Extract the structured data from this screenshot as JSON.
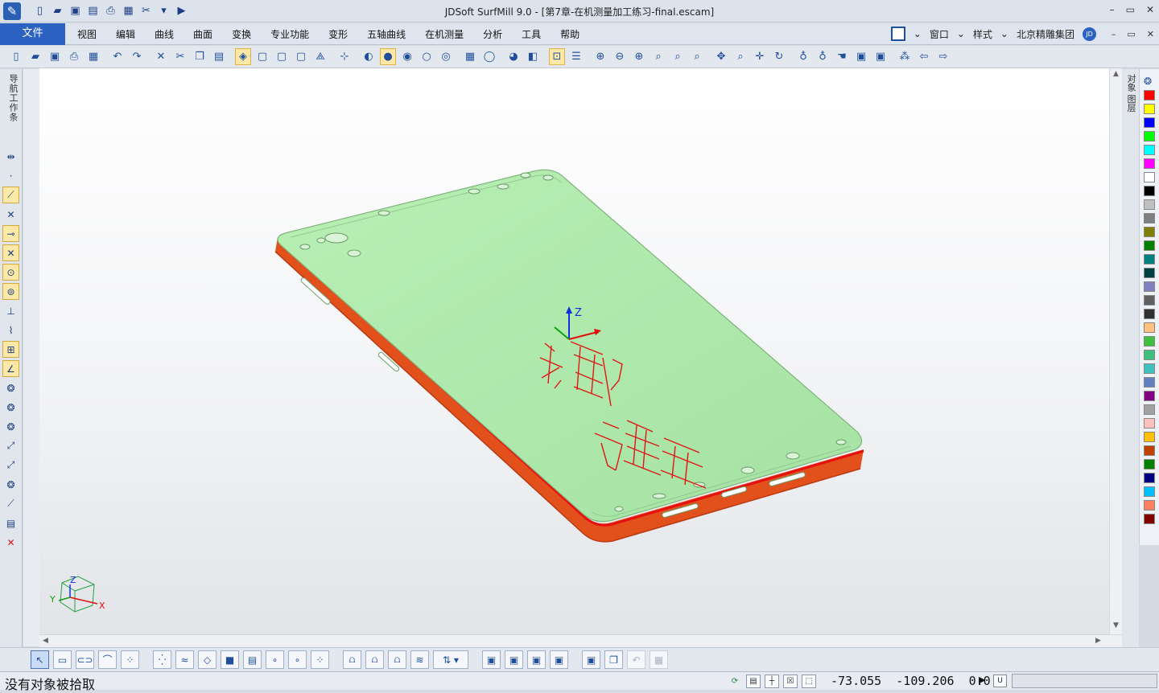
{
  "app": {
    "title": "JDSoft SurfMill 9.0 - [第7章-在机测量加工练习-final.escam]",
    "logo_icon": "surfmill-logo-icon"
  },
  "window_controls": {
    "minimize": "–",
    "restore": "▭",
    "close": "✕"
  },
  "quick_access": [
    "new-file-icon",
    "open-file-icon",
    "save-icon",
    "save-as-icon",
    "print-icon",
    "save-all-icon",
    "tools-icon",
    "dropdown-icon",
    "run-icon"
  ],
  "menu": {
    "file_label": "文件",
    "items": [
      "视图",
      "编辑",
      "曲线",
      "曲面",
      "变换",
      "专业功能",
      "变形",
      "五轴曲线",
      "在机测量",
      "分析",
      "工具",
      "帮助"
    ],
    "window_label": "窗口",
    "style_label": "样式",
    "company_label": "北京精雕集团",
    "avatar_text": "JD"
  },
  "left_panel": {
    "nav_tab": "导航工作条"
  },
  "right_panel": {
    "layer_tab": "对象 图层"
  },
  "viewport": {
    "axis_z_label": "Z",
    "triad": {
      "x": "X",
      "y": "Y",
      "z": "Z"
    },
    "engraved_text": "精雕"
  },
  "palette": {
    "colors": [
      "#ff0000",
      "#ffff00",
      "#0000ff",
      "#00ff00",
      "#00ffff",
      "#ff00ff",
      "#ffffff",
      "#000000",
      "#c0c0c0",
      "#808080",
      "#808000",
      "#008000",
      "#008080",
      "#004040",
      "#8080c0",
      "#606060",
      "#303030",
      "#ffc080",
      "#40c040",
      "#40c080",
      "#40c0c0",
      "#6080c0",
      "#800080",
      "#a0a0a0",
      "#ffc0c0",
      "#ffc000",
      "#c04000",
      "#008000",
      "#000080",
      "#00c0ff",
      "#ff8060",
      "#800000"
    ]
  },
  "status": {
    "message": "没有对象被拾取",
    "coordinates": "-73.055  -109.206  0.0",
    "unit_label": "U"
  },
  "colors": {
    "body": "#aee8ac",
    "side": "#e2501c",
    "edge_line": "#e61010",
    "menu_accent": "#2c63c2"
  }
}
